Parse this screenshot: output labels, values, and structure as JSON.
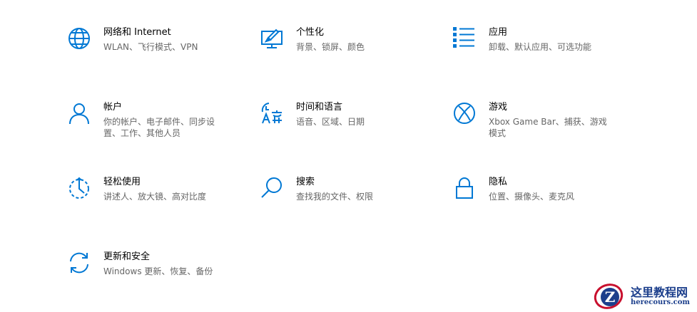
{
  "accent_color": "#0078d4",
  "tiles": [
    {
      "title": "网络和 Internet",
      "desc": "WLAN、飞行模式、VPN",
      "icon": "globe-icon"
    },
    {
      "title": "个性化",
      "desc": "背景、锁屏、颜色",
      "icon": "paint-brush-icon"
    },
    {
      "title": "应用",
      "desc": "卸载、默认应用、可选功能",
      "icon": "apps-list-icon"
    },
    {
      "title": "帐户",
      "desc": "你的帐户、电子邮件、同步设置、工作、其他人员",
      "icon": "person-icon"
    },
    {
      "title": "时间和语言",
      "desc": "语音、区域、日期",
      "icon": "time-language-icon"
    },
    {
      "title": "游戏",
      "desc": "Xbox Game Bar、捕获、游戏模式",
      "icon": "xbox-icon"
    },
    {
      "title": "轻松使用",
      "desc": "讲述人、放大镜、高对比度",
      "icon": "ease-of-access-icon"
    },
    {
      "title": "搜索",
      "desc": "查找我的文件、权限",
      "icon": "search-icon"
    },
    {
      "title": "隐私",
      "desc": "位置、摄像头、麦克风",
      "icon": "lock-icon"
    },
    {
      "title": "更新和安全",
      "desc": "Windows 更新、恢复、备份",
      "icon": "sync-icon"
    }
  ],
  "watermark": {
    "text": "这里教程网",
    "url": "herecours.com",
    "icon": "z-logo-icon"
  }
}
